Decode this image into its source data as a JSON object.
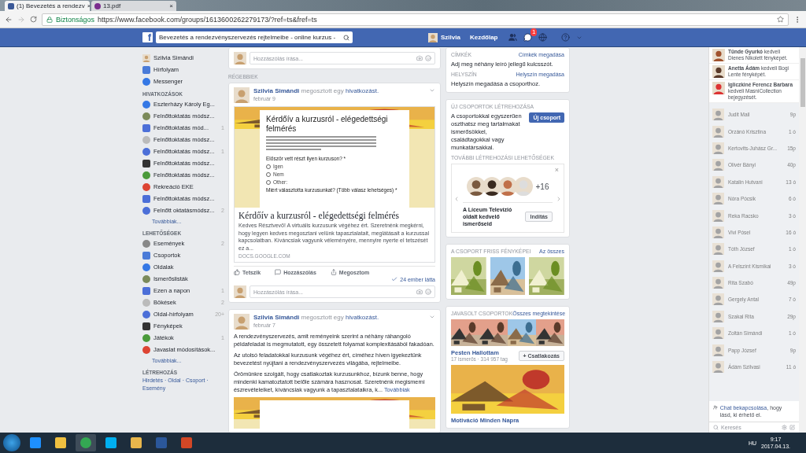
{
  "browser": {
    "tabs": [
      {
        "title": "(1) Bevezetés a rendezv",
        "selected": true
      },
      {
        "title": "13.pdf",
        "selected": false
      }
    ],
    "close_glyph": "×",
    "secure_label": "Biztonságos",
    "url": "https://www.facebook.com/groups/1613600262279173/?ref=ts&fref=ts"
  },
  "topbar": {
    "logo": "f",
    "search_value": "Bevezetés a rendezvényszervezés rejtelmeibe - online kurzus -",
    "user": "Szilvia",
    "home": "Kezdőlap",
    "messages_badge": "1"
  },
  "sidebar": {
    "profile": "Szilvia Simándi",
    "main": [
      {
        "label": "Hírfolyam"
      },
      {
        "label": "Messenger"
      }
    ],
    "sections": [
      {
        "title": "HIVATKOZÁSOK",
        "items": [
          {
            "label": "Eszterházy Károly Eg..."
          },
          {
            "label": "Felnőttoktatás módsz..."
          },
          {
            "label": "Felnőttoktatás mód...",
            "count": "1"
          },
          {
            "label": "Felnőttoktatás módsz..."
          },
          {
            "label": "Felnőttoktatás módsz...",
            "count": "1"
          },
          {
            "label": "Felnőttoktatás módsz..."
          },
          {
            "label": "Felnőttoktatás módsz..."
          },
          {
            "label": "Rekreáció EKE"
          },
          {
            "label": "Felnőttoktatás módsz..."
          },
          {
            "label": "Felnőtt oktatásmódsz...",
            "count": "2"
          }
        ],
        "more": "Továbbiak..."
      },
      {
        "title": "LEHETŐSÉGEK",
        "items": [
          {
            "label": "Események",
            "count": "2"
          },
          {
            "label": "Csoportok"
          },
          {
            "label": "Oldalak"
          },
          {
            "label": "Ismerőslisták"
          },
          {
            "label": "Ezen a napon",
            "count": "1"
          },
          {
            "label": "Bökések",
            "count": "2"
          },
          {
            "label": "Oldal-hírfolyam",
            "count": "20+"
          },
          {
            "label": "Fényképek"
          },
          {
            "label": "Játékok",
            "count": "1"
          },
          {
            "label": "Javaslat módosítások..."
          }
        ],
        "more": "Továbbiak..."
      }
    ],
    "create": {
      "title": "LÉTREHOZÁS",
      "links": [
        "Hirdetés",
        "Oldal",
        "Csoport",
        "Esemény"
      ],
      "separator": "·"
    }
  },
  "feed": {
    "comment_placeholder": "Hozzászólás írása...",
    "older_label": "RÉGEBBIEK",
    "posts": [
      {
        "author": "Szilvia Simándi",
        "action": "megosztott egy",
        "link": "hivatkozást.",
        "date": "február 9",
        "comment_placeholder": "Hozzászólás írása...",
        "preview": {
          "form_title": "Kérdőív a kurzusról - elégedettségi felmérés",
          "question": "Először vett részt ilyen kurzuson? *",
          "options": [
            {
              "label": "Igen",
              "selected": false
            },
            {
              "label": "Nem",
              "selected": false
            },
            {
              "label": "Other:",
              "selected": false
            }
          ],
          "question2": "Miért választotta kurzusunkat? (Több válasz lehetséges) *",
          "title": "Kérdőív a kurzusról - elégedettségi felmérés",
          "description": "Kedves Résztvevő! A virtuális kurzusunk végéhez ért. Szeretnénk megkérni, hogy legyen kedves megosztani velünk tapasztalatait, meglátásait a kurzussal kapcsolatban. Kíváncsiak vagyunk véleményére, mennyire nyerte el tetszését ez a...",
          "domain": "DOCS.GOOGLE.COM"
        },
        "actions": [
          "Tetszik",
          "Hozzászólás",
          "Megosztom"
        ],
        "seen": "24 ember látta"
      },
      {
        "author": "Szilvia Simándi",
        "action": "megosztott egy",
        "link": "hivatkozást.",
        "date": "február 7",
        "paragraphs": [
          "A rendezvényszervezés, amit reményeink szerint a néhány ráhangoló példafeladat is megmutatott, egy összetett folyamat komplexitásából fakadóan.",
          "Az utolsó feladatokkal kurzusunk végéhez ért, címéhez híven igyekeztünk bevezetést nyújtani a rendezvényszervezés világába, rejtelmeibe.",
          "Örömünkre szolgált, hogy csatlakoztak kurzusunkhoz, bízunk benne, hogy mindenki kamatoztatott belőle számára hasznosat. Szeretnénk megismerni észrevételeiket, kíváncsiak vagyunk a tapasztalataikra, k..."
        ],
        "more": "Továbbiak"
      }
    ]
  },
  "right": {
    "info": [
      {
        "label": "CÍMKÉK",
        "link": "Címkék megadása",
        "text": "Adj meg néhány leíró jellegű kulcsszót."
      },
      {
        "label": "HELYSZÍN",
        "link": "Helyszín megadása",
        "text": "Helyszín megadása a csoporthoz."
      }
    ],
    "new_group": {
      "title": "ÚJ CSOPORTOK LÉTREHOZÁSA",
      "text": "A csoportokkal egyszerűen oszthatsz meg tartalmakat ismerősökkel, családtagokkal vagy munkatársakkal.",
      "button": "Új csoport",
      "more_title": "TOVÁBBI LÉTREHOZÁSI LEHETŐSÉGEK",
      "close": "×",
      "extra": "+16",
      "suggestion": "A Líceum Televízió oldalt kedvelő ismerőseid",
      "start": "Indítás"
    },
    "photos": {
      "title": "A CSOPORT FRISS FÉNYKÉPEI",
      "link": "Az összes"
    },
    "suggested": {
      "title": "JAVASOLT CSOPORTOK",
      "link": "Összes megtekintése",
      "groups": [
        {
          "name": "Pesten Hallottam",
          "meta": "17 ismerős · 314 957 tag",
          "join": "+ Csatlakozás"
        },
        {
          "name": "Motiváció Minden Napra"
        }
      ]
    }
  },
  "chat": {
    "activity": [
      {
        "text": "**Tünde Gyurkó** kedveli Dienes Nikolett fényképét."
      },
      {
        "text": "**Anetta Ádám** kedveli Bogi Lente fényképét."
      },
      {
        "text": "**Igliczkiné Ferencz Barbara** kedveli MasniCollection bejegyzését."
      }
    ],
    "contacts_faded": true,
    "contacts": [
      {
        "name": "Judit Mail",
        "time": "9p"
      },
      {
        "name": "Orzánó Krisztina",
        "time": "1 ó"
      },
      {
        "name": "Kertovits-Juhász Gr...",
        "time": "15p"
      },
      {
        "name": "Olivér Bányi",
        "time": "40p"
      },
      {
        "name": "Katalin Hutvani",
        "time": "13 ó"
      },
      {
        "name": "Nóra Pócsik",
        "time": "6 ó"
      },
      {
        "name": "Reka Racsko",
        "time": "3 ó"
      },
      {
        "name": "Vivi Pósel",
        "time": "16 ó"
      },
      {
        "name": "Tóth József",
        "time": "1 ó"
      },
      {
        "name": "A Felszínt Kismikai",
        "time": "3 ó"
      },
      {
        "name": "Rita Szabó",
        "time": "49p"
      },
      {
        "name": "Gergely Antal",
        "time": "7 ó"
      },
      {
        "name": "Szakal Rita",
        "time": "29p"
      },
      {
        "name": "Zoltán Simándi",
        "time": "1 ó"
      },
      {
        "name": "Papp József",
        "time": "9p"
      },
      {
        "name": "Ádám Szilvasi",
        "time": "11 ó"
      }
    ],
    "notice_link": "Chat bekapcsolása",
    "notice_rest": ", hogy lásd, ki érhető el.",
    "search_placeholder": "Keresés"
  },
  "taskbar": {
    "language": "HU",
    "time": "9:17",
    "date": "2017.04.13."
  }
}
